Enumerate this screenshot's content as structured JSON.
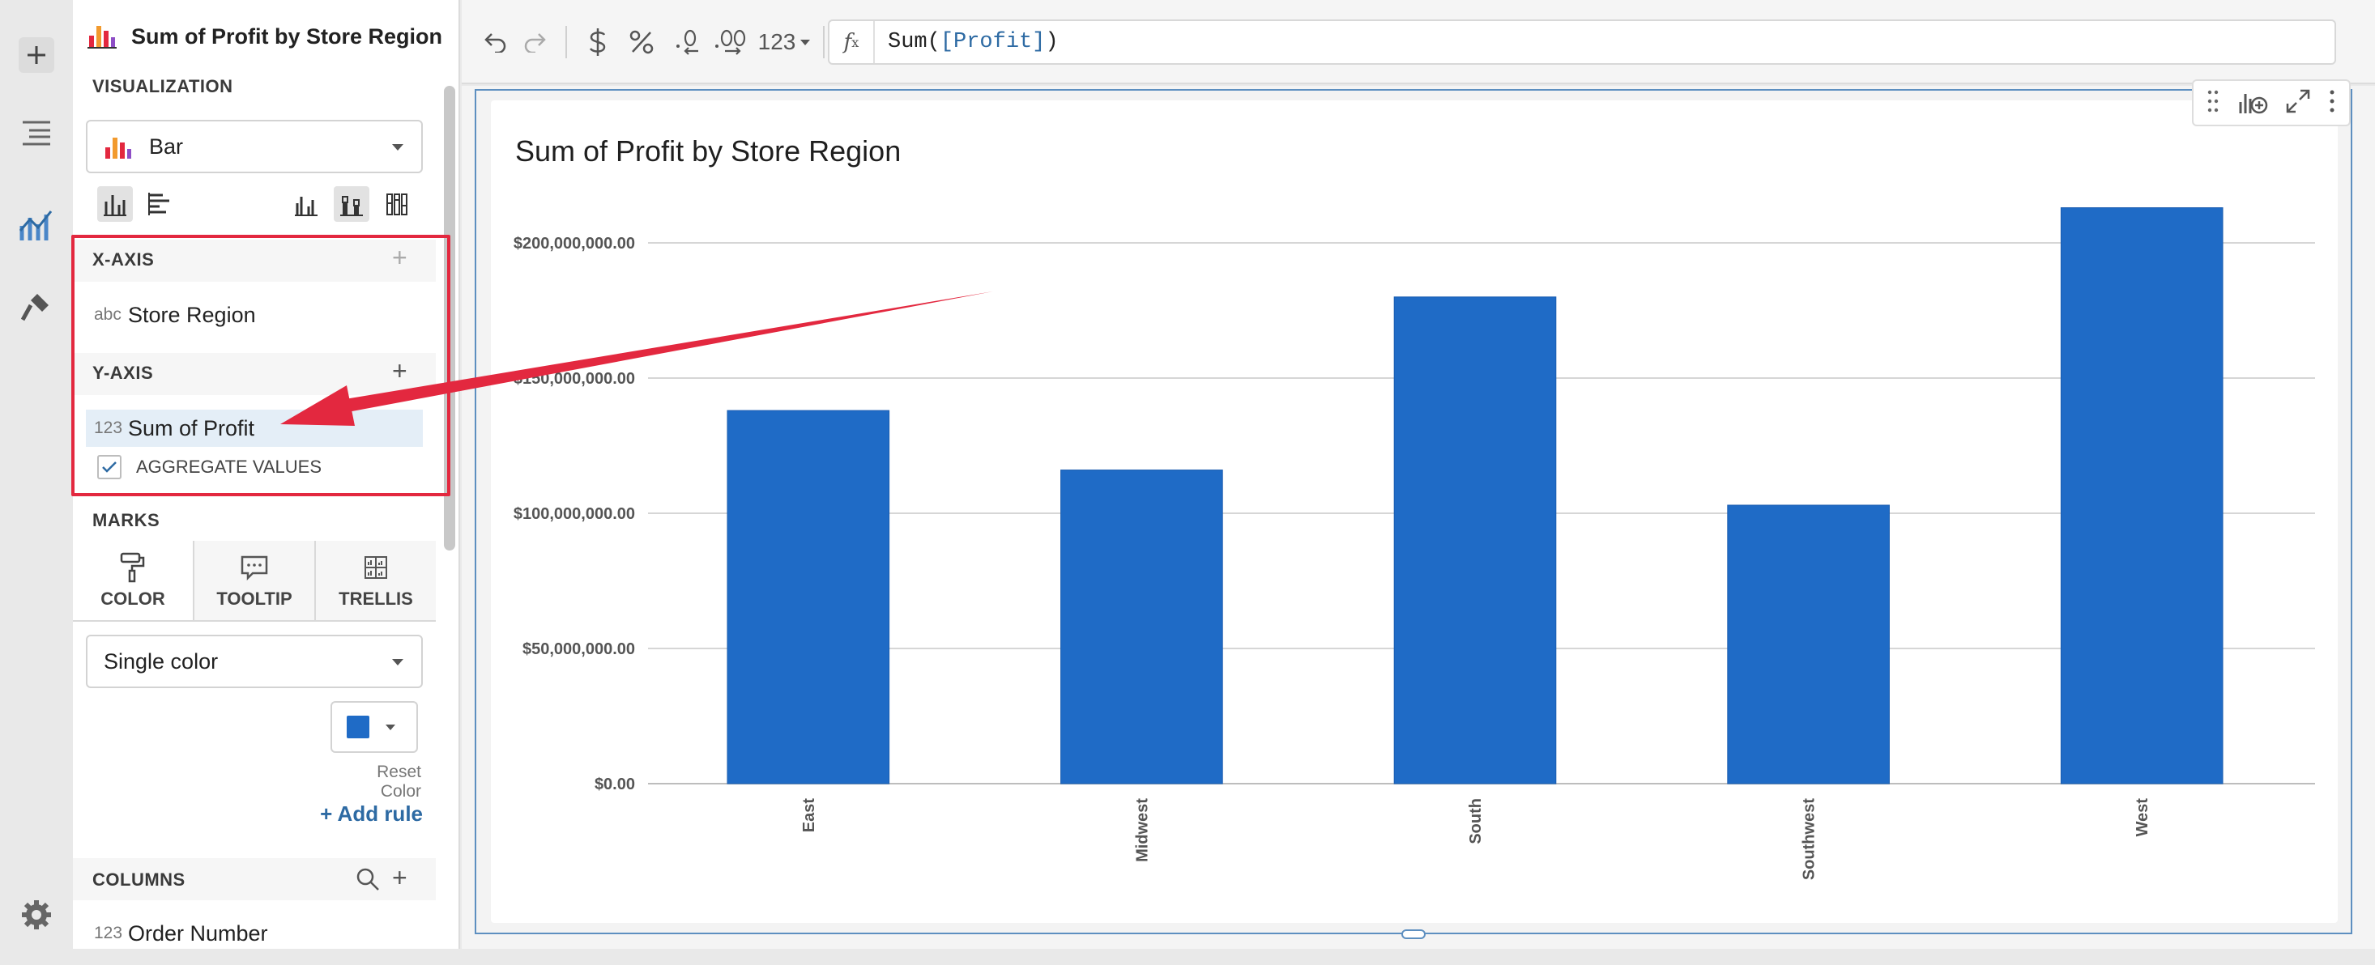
{
  "rail": {
    "items": [
      {
        "name": "add-element-icon"
      },
      {
        "name": "outline-icon"
      },
      {
        "name": "chart-properties-icon"
      },
      {
        "name": "format-brush-icon"
      },
      {
        "name": "settings-gear-icon"
      }
    ]
  },
  "panel": {
    "title": "Sum of Profit by Store Region",
    "visualization_label": "VISUALIZATION",
    "chart_type": "Bar",
    "xaxis_label": "X-AXIS",
    "xaxis_field": {
      "type": "abc",
      "name": "Store Region"
    },
    "yaxis_label": "Y-AXIS",
    "yaxis_field": {
      "type": "123",
      "name": "Sum of Profit"
    },
    "aggregate_label": "AGGREGATE VALUES",
    "aggregate_checked": true,
    "marks_label": "MARKS",
    "tabs": [
      {
        "label": "COLOR",
        "icon": "paint-roller-icon"
      },
      {
        "label": "TOOLTIP",
        "icon": "tooltip-icon"
      },
      {
        "label": "TRELLIS",
        "icon": "trellis-icon"
      }
    ],
    "color_mode": "Single color",
    "color_swatch": "#1f6bc6",
    "reset_color": "Reset Color",
    "add_rule": "+ Add rule",
    "columns_label": "COLUMNS",
    "columns": [
      {
        "type": "123",
        "name": "Order Number"
      }
    ]
  },
  "toolbar": {
    "format_number": "123",
    "formula": "Sum(",
    "formula_ref": "[Profit]",
    "formula_end": ")"
  },
  "chart_data": {
    "type": "bar",
    "title": "Sum of Profit by Store Region",
    "categories": [
      "East",
      "Midwest",
      "South",
      "Southwest",
      "West"
    ],
    "values": [
      138000000,
      116000000,
      180000000,
      103000000,
      213000000
    ],
    "ylim": [
      0,
      200000000
    ],
    "yticks": [
      "$0.00",
      "$50,000,000.00",
      "$100,000,000.00",
      "$150,000,000.00",
      "$200,000,000.00"
    ],
    "grid": true,
    "bar_color": "#1f6bc6"
  },
  "colors": {
    "highlight": "#e3283f",
    "accent_blue": "#1f6bc6",
    "frame_blue": "#5d8fc0"
  }
}
